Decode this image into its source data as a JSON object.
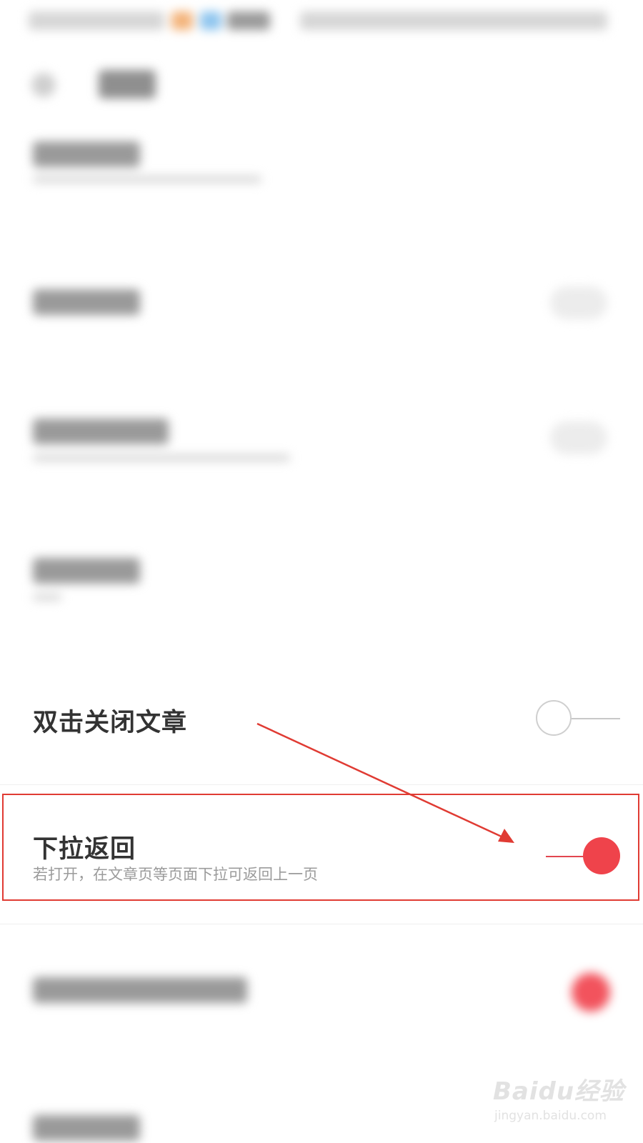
{
  "settings": {
    "double_tap_close": {
      "title": "双击关闭文章",
      "on": false
    },
    "pull_down_back": {
      "title": "下拉返回",
      "subtitle": "若打开，在文章页等页面下拉可返回上一页",
      "on": true
    }
  },
  "watermark": {
    "brand": "Baidu经验",
    "url": "jingyan.baidu.com"
  },
  "colors": {
    "accent": "#ef434b",
    "annotation": "#e03b33",
    "text": "#333333",
    "subtext": "#9b9b9b"
  }
}
